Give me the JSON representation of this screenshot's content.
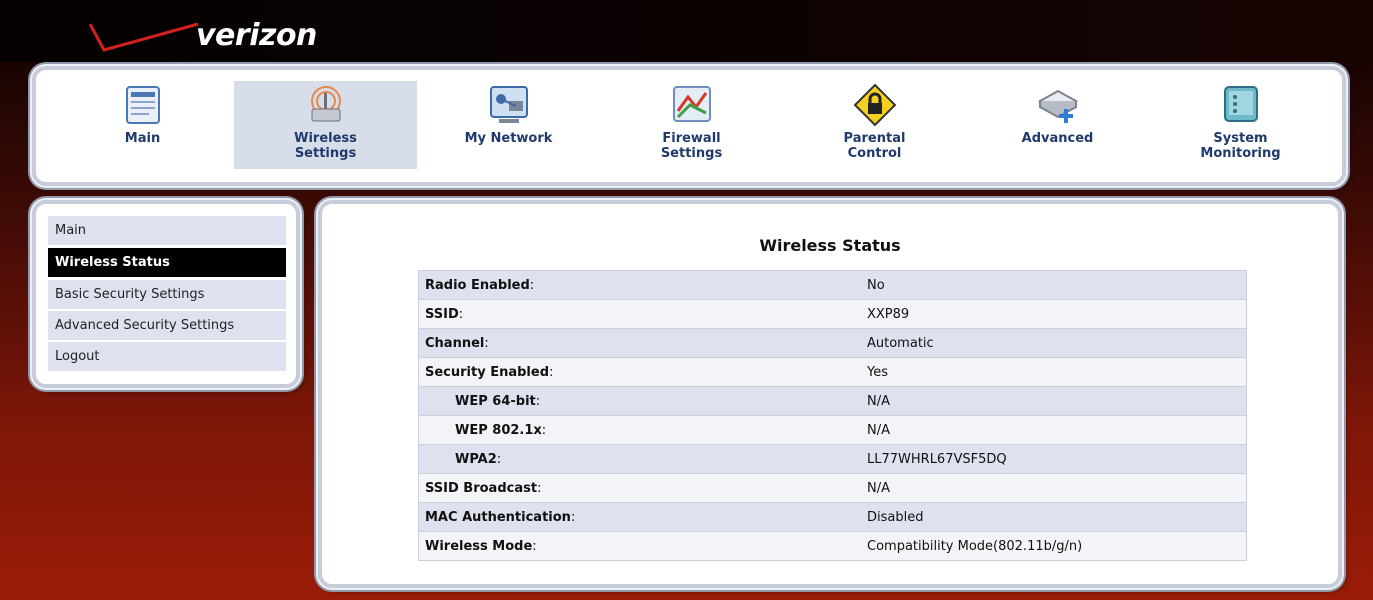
{
  "brand": {
    "logo_text": "verizon"
  },
  "nav": {
    "items": [
      {
        "label": "Main",
        "icon": "main-page-icon"
      },
      {
        "label": "Wireless Settings",
        "icon": "wireless-router-icon"
      },
      {
        "label": "My Network",
        "icon": "network-icon"
      },
      {
        "label": "Firewall Settings",
        "icon": "firewall-icon"
      },
      {
        "label": "Parental Control",
        "icon": "lock-sign-icon"
      },
      {
        "label": "Advanced",
        "icon": "advanced-icon"
      },
      {
        "label": "System Monitoring",
        "icon": "monitor-icon"
      }
    ],
    "active": "Wireless Settings"
  },
  "sidebar": {
    "items": [
      {
        "label": "Main"
      },
      {
        "label": "Wireless Status"
      },
      {
        "label": "Basic Security Settings"
      },
      {
        "label": "Advanced Security Settings"
      },
      {
        "label": "Logout"
      }
    ],
    "active": "Wireless Status"
  },
  "content": {
    "title": "Wireless Status",
    "rows": [
      {
        "label": "Radio Enabled",
        "value": "No"
      },
      {
        "label": "SSID",
        "value": "XXP89"
      },
      {
        "label": "Channel",
        "value": "Automatic"
      },
      {
        "label": "Security Enabled",
        "value": "Yes"
      },
      {
        "label": "WEP 64-bit",
        "value": "N/A"
      },
      {
        "label": "WEP 802.1x",
        "value": "N/A"
      },
      {
        "label": "WPA2",
        "value": "LL77WHRL67VSF5DQ"
      },
      {
        "label": "SSID Broadcast",
        "value": "N/A"
      },
      {
        "label": "MAC Authentication",
        "value": "Disabled"
      },
      {
        "label": "Wireless Mode",
        "value": "Compatibility Mode(802.11b/g/n)"
      }
    ]
  },
  "colors": {
    "accent": "#1f3a6b",
    "active_tab": "#d7dde9",
    "row_alt": "#dde2ee",
    "brand_red": "#d1221d"
  }
}
